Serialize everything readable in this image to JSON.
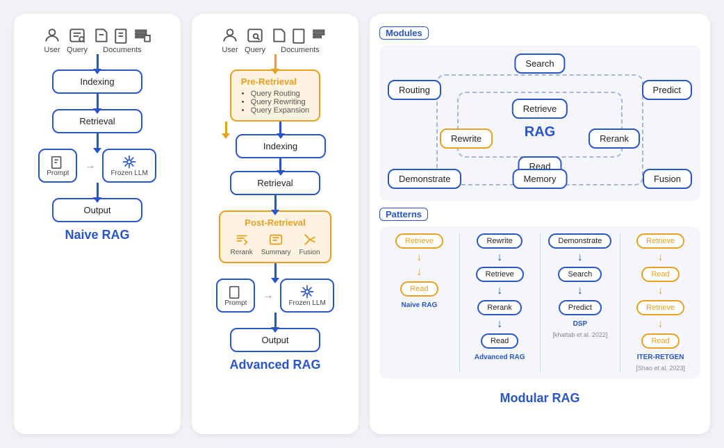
{
  "naive_rag": {
    "title": "Naive RAG",
    "inputs": [
      {
        "label": "User"
      },
      {
        "label": "Query"
      },
      {
        "label": "Documents"
      }
    ],
    "steps": [
      "Indexing",
      "Retrieval",
      "Output"
    ],
    "prompt_label": "Prompt",
    "frozen_label": "Frozen LLM"
  },
  "advanced_rag": {
    "title": "Advanced RAG",
    "pre_retrieval": {
      "title": "Pre-Retrieval",
      "items": [
        "Query Routing",
        "Query Rewriting",
        "Query Expansion"
      ]
    },
    "post_retrieval": {
      "title": "Post-Retrieval",
      "items": [
        "Rerank",
        "Summary",
        "Fusion"
      ]
    },
    "steps": [
      "Indexing",
      "Retrieval",
      "Output"
    ],
    "prompt_label": "Prompt",
    "frozen_label": "Frozen LLM"
  },
  "modular_rag": {
    "title": "Modular RAG",
    "modules_label": "Modules",
    "patterns_label": "Patterns",
    "modules": [
      {
        "label": "Search",
        "pos": "top-center"
      },
      {
        "label": "Routing",
        "pos": "left"
      },
      {
        "label": "Predict",
        "pos": "right"
      },
      {
        "label": "Retrieve",
        "pos": "inner-top"
      },
      {
        "label": "Rewrite",
        "pos": "inner-left"
      },
      {
        "label": "RAG",
        "pos": "inner-center"
      },
      {
        "label": "Rerank",
        "pos": "inner-right"
      },
      {
        "label": "Read",
        "pos": "inner-bottom"
      },
      {
        "label": "Demonstrate",
        "pos": "outer-left-bottom"
      },
      {
        "label": "Fusion",
        "pos": "outer-right-bottom"
      },
      {
        "label": "Memory",
        "pos": "bottom-center"
      }
    ],
    "patterns": [
      {
        "name": "Naive RAG",
        "steps": [
          "Retrieve",
          "Read"
        ],
        "arrow_color": "orange"
      },
      {
        "name": "Advanced RAG",
        "steps": [
          "Rewrite",
          "Retrieve",
          "Rerank",
          "Read"
        ],
        "arrow_color": "blue"
      },
      {
        "name": "DSP",
        "subtitle": "[khattab et al. 2022]",
        "steps": [
          "Demonstrate",
          "Search",
          "Predict"
        ],
        "arrow_color": "blue"
      },
      {
        "name": "ITER-RETGEN",
        "subtitle": "[Shao et al. 2023]",
        "steps": [
          "Retrieve",
          "Read",
          "Retrieve",
          "Read"
        ],
        "arrow_color": "orange",
        "has_loop": true
      }
    ]
  }
}
